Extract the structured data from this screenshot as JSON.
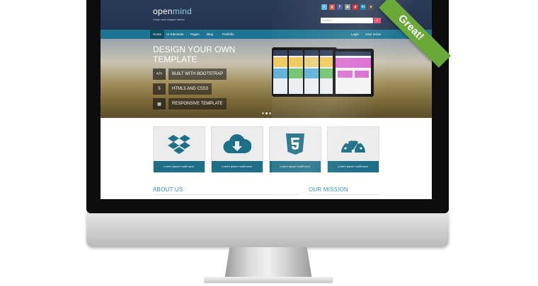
{
  "site": {
    "logo_prefix": "open",
    "logo_suffix": "mind",
    "tagline": "Clean and elegant theme",
    "search_placeholder": "Search..."
  },
  "social_icons": [
    {
      "name": "twitter-icon",
      "glyph": "t",
      "color": "#4fb6e8"
    },
    {
      "name": "google-plus-icon",
      "glyph": "g",
      "color": "#dd4b39"
    },
    {
      "name": "facebook-icon",
      "glyph": "f",
      "color": "#3b5998"
    },
    {
      "name": "instagram-icon",
      "glyph": "◙",
      "color": "#8a8a8a"
    },
    {
      "name": "pinterest-icon",
      "glyph": "p",
      "color": "#cb2027"
    },
    {
      "name": "linkedin-icon",
      "glyph": "in",
      "color": "#0e76a8"
    },
    {
      "name": "github-icon",
      "glyph": "●",
      "color": "#444444"
    }
  ],
  "nav": {
    "items": [
      "Home",
      "UI Elements",
      "Pages",
      "Blog",
      "Portfolio"
    ],
    "right": [
      "Login",
      "User name"
    ]
  },
  "hero": {
    "title": "DESIGN YOUR OWN TEMPLATE",
    "buttons": [
      {
        "icon": "code-icon",
        "glyph": "</>",
        "label": "BUILT WITH BOOTSTRAP"
      },
      {
        "icon": "html5-icon",
        "glyph": "5",
        "label": "HTML5 AND CSS3"
      },
      {
        "icon": "grid-icon",
        "glyph": "▦",
        "label": "RESPONSIVE TEMPLATE"
      }
    ]
  },
  "features": [
    {
      "icon": "dropbox-icon",
      "caption": "Lorem ipsum mollit sunt."
    },
    {
      "icon": "cloud-download-icon",
      "caption": "Lorem ipsum mollit sunt."
    },
    {
      "icon": "html5-shield-icon",
      "caption": "Lorem ipsum mollit sunt."
    },
    {
      "icon": "speedometer-icon",
      "caption": "Lorem ipsum mollit sunt."
    }
  ],
  "sections": {
    "about": "ABOUT US",
    "mission": "OUR MISSION"
  },
  "ribbon": "Great!",
  "colors": {
    "header": "#243450",
    "nav": "#1d7591",
    "accent": "#1d6f87",
    "ribbon": "#6aa83a"
  }
}
